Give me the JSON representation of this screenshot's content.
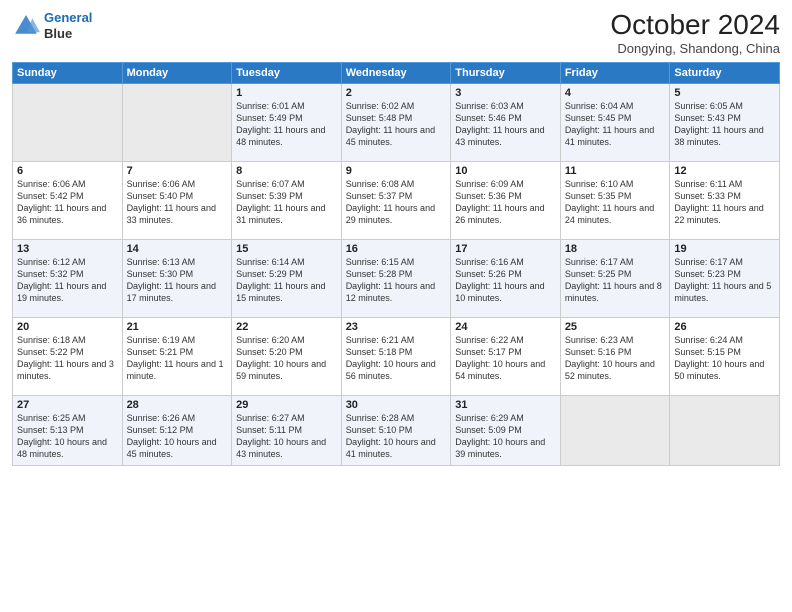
{
  "header": {
    "logo_line1": "General",
    "logo_line2": "Blue",
    "month": "October 2024",
    "location": "Dongying, Shandong, China"
  },
  "weekdays": [
    "Sunday",
    "Monday",
    "Tuesday",
    "Wednesday",
    "Thursday",
    "Friday",
    "Saturday"
  ],
  "weeks": [
    [
      {
        "day": "",
        "empty": true
      },
      {
        "day": "",
        "empty": true
      },
      {
        "day": "1",
        "sunrise": "6:01 AM",
        "sunset": "5:49 PM",
        "daylight": "11 hours and 48 minutes."
      },
      {
        "day": "2",
        "sunrise": "6:02 AM",
        "sunset": "5:48 PM",
        "daylight": "11 hours and 45 minutes."
      },
      {
        "day": "3",
        "sunrise": "6:03 AM",
        "sunset": "5:46 PM",
        "daylight": "11 hours and 43 minutes."
      },
      {
        "day": "4",
        "sunrise": "6:04 AM",
        "sunset": "5:45 PM",
        "daylight": "11 hours and 41 minutes."
      },
      {
        "day": "5",
        "sunrise": "6:05 AM",
        "sunset": "5:43 PM",
        "daylight": "11 hours and 38 minutes."
      }
    ],
    [
      {
        "day": "6",
        "sunrise": "6:06 AM",
        "sunset": "5:42 PM",
        "daylight": "11 hours and 36 minutes."
      },
      {
        "day": "7",
        "sunrise": "6:06 AM",
        "sunset": "5:40 PM",
        "daylight": "11 hours and 33 minutes."
      },
      {
        "day": "8",
        "sunrise": "6:07 AM",
        "sunset": "5:39 PM",
        "daylight": "11 hours and 31 minutes."
      },
      {
        "day": "9",
        "sunrise": "6:08 AM",
        "sunset": "5:37 PM",
        "daylight": "11 hours and 29 minutes."
      },
      {
        "day": "10",
        "sunrise": "6:09 AM",
        "sunset": "5:36 PM",
        "daylight": "11 hours and 26 minutes."
      },
      {
        "day": "11",
        "sunrise": "6:10 AM",
        "sunset": "5:35 PM",
        "daylight": "11 hours and 24 minutes."
      },
      {
        "day": "12",
        "sunrise": "6:11 AM",
        "sunset": "5:33 PM",
        "daylight": "11 hours and 22 minutes."
      }
    ],
    [
      {
        "day": "13",
        "sunrise": "6:12 AM",
        "sunset": "5:32 PM",
        "daylight": "11 hours and 19 minutes."
      },
      {
        "day": "14",
        "sunrise": "6:13 AM",
        "sunset": "5:30 PM",
        "daylight": "11 hours and 17 minutes."
      },
      {
        "day": "15",
        "sunrise": "6:14 AM",
        "sunset": "5:29 PM",
        "daylight": "11 hours and 15 minutes."
      },
      {
        "day": "16",
        "sunrise": "6:15 AM",
        "sunset": "5:28 PM",
        "daylight": "11 hours and 12 minutes."
      },
      {
        "day": "17",
        "sunrise": "6:16 AM",
        "sunset": "5:26 PM",
        "daylight": "11 hours and 10 minutes."
      },
      {
        "day": "18",
        "sunrise": "6:17 AM",
        "sunset": "5:25 PM",
        "daylight": "11 hours and 8 minutes."
      },
      {
        "day": "19",
        "sunrise": "6:17 AM",
        "sunset": "5:23 PM",
        "daylight": "11 hours and 5 minutes."
      }
    ],
    [
      {
        "day": "20",
        "sunrise": "6:18 AM",
        "sunset": "5:22 PM",
        "daylight": "11 hours and 3 minutes."
      },
      {
        "day": "21",
        "sunrise": "6:19 AM",
        "sunset": "5:21 PM",
        "daylight": "11 hours and 1 minute."
      },
      {
        "day": "22",
        "sunrise": "6:20 AM",
        "sunset": "5:20 PM",
        "daylight": "10 hours and 59 minutes."
      },
      {
        "day": "23",
        "sunrise": "6:21 AM",
        "sunset": "5:18 PM",
        "daylight": "10 hours and 56 minutes."
      },
      {
        "day": "24",
        "sunrise": "6:22 AM",
        "sunset": "5:17 PM",
        "daylight": "10 hours and 54 minutes."
      },
      {
        "day": "25",
        "sunrise": "6:23 AM",
        "sunset": "5:16 PM",
        "daylight": "10 hours and 52 minutes."
      },
      {
        "day": "26",
        "sunrise": "6:24 AM",
        "sunset": "5:15 PM",
        "daylight": "10 hours and 50 minutes."
      }
    ],
    [
      {
        "day": "27",
        "sunrise": "6:25 AM",
        "sunset": "5:13 PM",
        "daylight": "10 hours and 48 minutes."
      },
      {
        "day": "28",
        "sunrise": "6:26 AM",
        "sunset": "5:12 PM",
        "daylight": "10 hours and 45 minutes."
      },
      {
        "day": "29",
        "sunrise": "6:27 AM",
        "sunset": "5:11 PM",
        "daylight": "10 hours and 43 minutes."
      },
      {
        "day": "30",
        "sunrise": "6:28 AM",
        "sunset": "5:10 PM",
        "daylight": "10 hours and 41 minutes."
      },
      {
        "day": "31",
        "sunrise": "6:29 AM",
        "sunset": "5:09 PM",
        "daylight": "10 hours and 39 minutes."
      },
      {
        "day": "",
        "empty": true
      },
      {
        "day": "",
        "empty": true
      }
    ]
  ]
}
